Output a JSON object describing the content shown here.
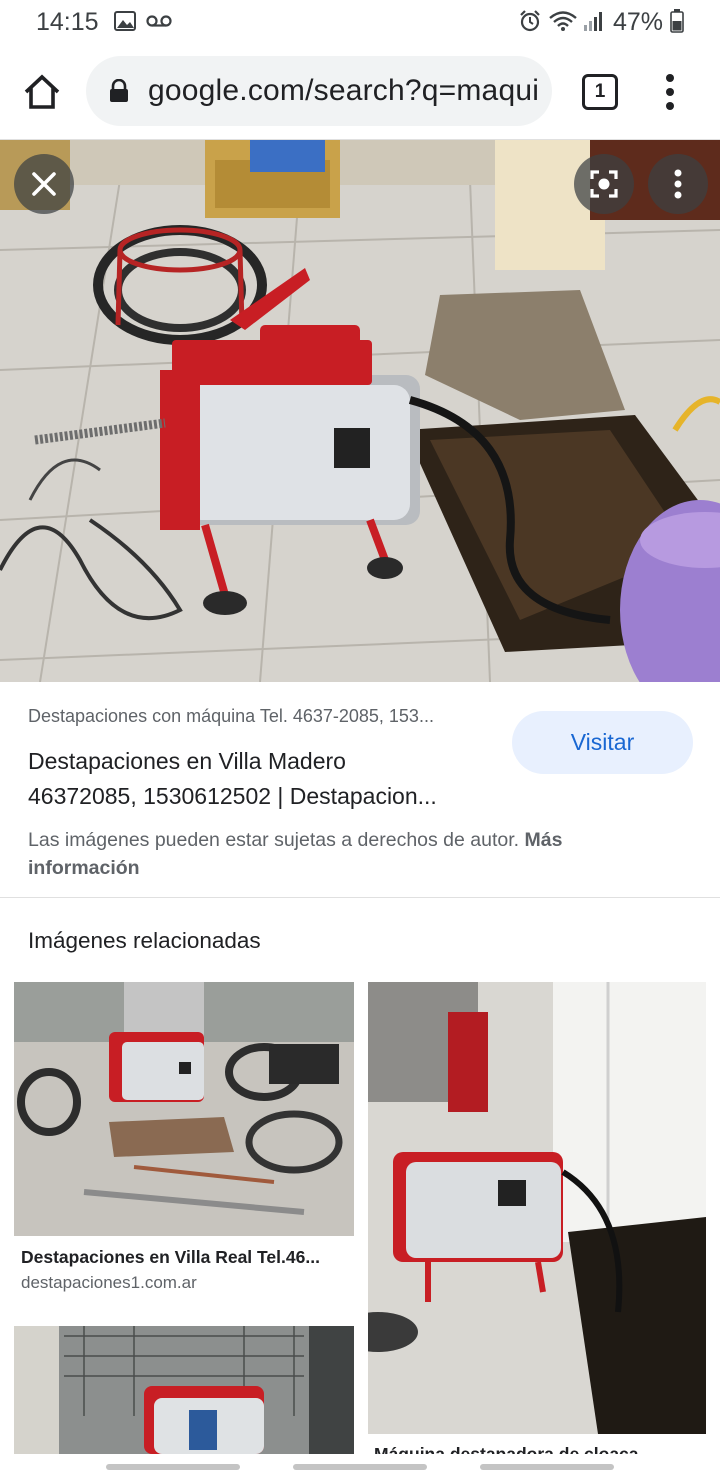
{
  "status_bar": {
    "time": "14:15",
    "battery": "47%",
    "icons": [
      "image-icon",
      "voicemail-icon",
      "alarm-icon",
      "wifi-icon",
      "signal-icon",
      "battery-icon"
    ]
  },
  "toolbar": {
    "url": "google.com/search?q=maquina",
    "tab_count": "1"
  },
  "result": {
    "source": "Destapaciones con máquina Tel. 4637-2085, 153...",
    "title_line1": "Destapaciones en Villa Madero",
    "title_line2": "46372085, 1530612502 | Destapacion...",
    "visit_label": "Visitar",
    "copyright_text": "Las imágenes pueden estar sujetas a derechos de autor.",
    "more_info": "Más información"
  },
  "related": {
    "heading": "Imágenes relacionadas",
    "items": [
      {
        "title": "Destapaciones en Villa Real Tel.46...",
        "domain": "destapaciones1.com.ar"
      },
      {
        "title": "Máquina destapadora de cloaca"
      }
    ]
  },
  "colors": {
    "accent": "#1967d2",
    "visit_bg": "#e8f0fe",
    "machine_red": "#c81e24"
  }
}
